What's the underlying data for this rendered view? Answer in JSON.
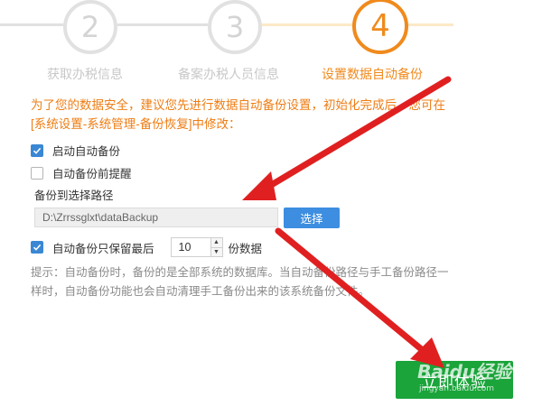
{
  "stepper": {
    "steps": [
      {
        "number": "2",
        "label": "获取办税信息",
        "state": "done"
      },
      {
        "number": "3",
        "label": "备案办税人员信息",
        "state": "done"
      },
      {
        "number": "4",
        "label": "设置数据自动备份",
        "state": "active"
      }
    ]
  },
  "notice": "为了您的数据安全，建议您先进行数据自动备份设置，初始化完成后，您可在[系统设置-系统管理-备份恢复]中修改：",
  "options": {
    "auto_backup": {
      "label": "启动自动备份",
      "checked": true
    },
    "backup_reminder": {
      "label": "自动备份前提醒",
      "checked": false
    }
  },
  "path": {
    "title": "备份到选择路径",
    "value": "D:\\Zrrssglxt\\dataBackup",
    "select_label": "选择"
  },
  "keep": {
    "checked": true,
    "prefix": "自动备份只保留最后",
    "value": "10",
    "suffix": "份数据"
  },
  "hint": "提示：自动备份时，备份的是全部系统的数据库。当自动备份路径与手工备份路径一样时，自动备份功能也会自动清理手工备份出来的该系统备份文件。",
  "cta_label": "立即体验",
  "watermark": {
    "main": "Baidu经验",
    "sub": "jingyan.baidu.com"
  },
  "colors": {
    "accent_orange": "#f08a1d",
    "primary_blue": "#3d8ee0",
    "cta_green": "#1aa43a",
    "annotation_red": "#e02020"
  }
}
